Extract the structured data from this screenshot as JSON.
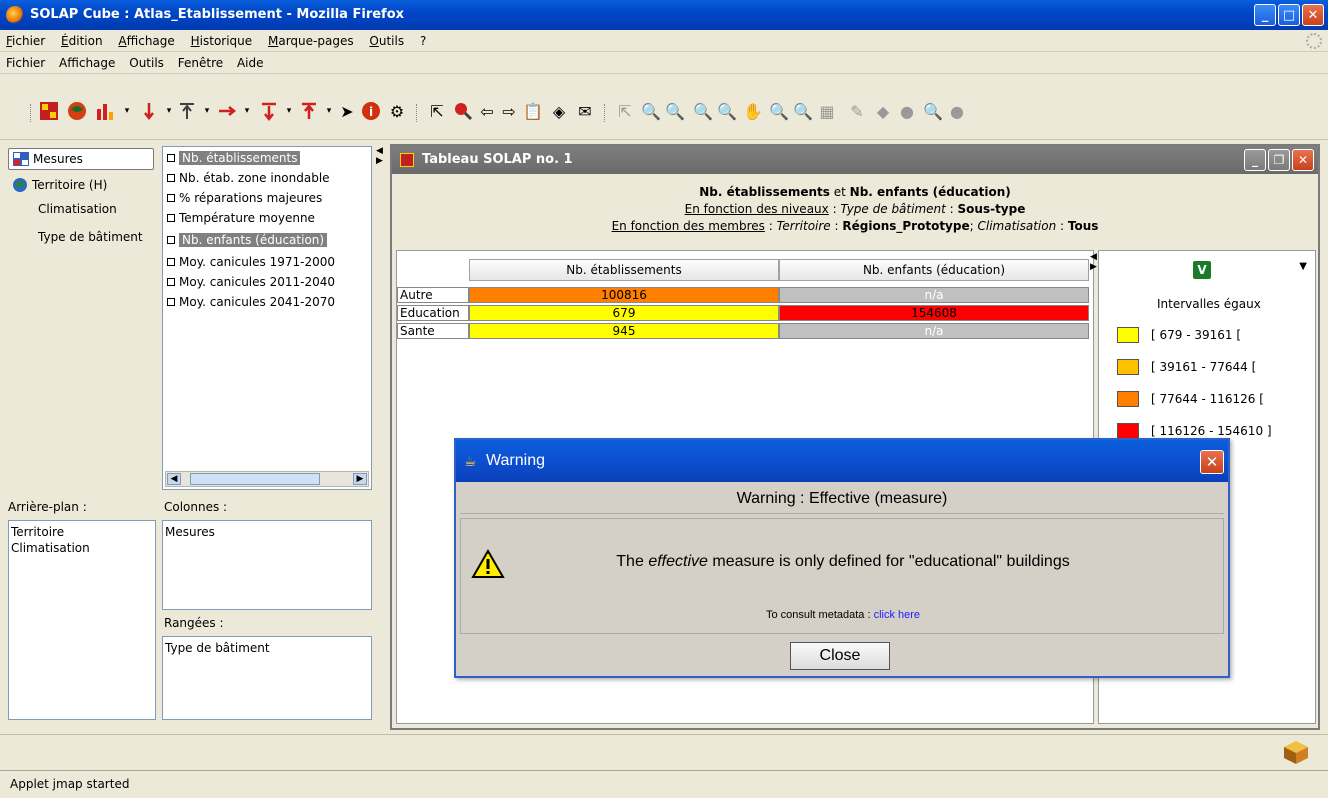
{
  "window": {
    "title": "SOLAP Cube : Atlas_Etablissement - Mozilla Firefox"
  },
  "browser_menu": [
    "Fichier",
    "Édition",
    "Affichage",
    "Historique",
    "Marque-pages",
    "Outils",
    "?"
  ],
  "app_menu": [
    "Fichier",
    "Affichage",
    "Outils",
    "Fenêtre",
    "Aide"
  ],
  "dimensions": [
    {
      "label": "Mesures",
      "icon": "measures-icon",
      "selected": true
    },
    {
      "label": "Territoire (H)",
      "icon": "globe-icon",
      "selected": false
    },
    {
      "label": "Climatisation",
      "icon": "",
      "selected": false
    },
    {
      "label": "Type de bâtiment",
      "icon": "",
      "selected": false
    }
  ],
  "measures": [
    {
      "label": "Nb. établissements",
      "selected": true
    },
    {
      "label": "Nb. étab. zone inondable",
      "selected": false
    },
    {
      "label": "% réparations majeures",
      "selected": false
    },
    {
      "label": "Température moyenne",
      "selected": false
    },
    {
      "label": "Nb. enfants (éducation)",
      "selected": true
    },
    {
      "label": "Moy. canicules 1971-2000",
      "selected": false
    },
    {
      "label": "Moy. canicules 2011-2040",
      "selected": false
    },
    {
      "label": "Moy. canicules 2041-2070",
      "selected": false
    }
  ],
  "background_section": {
    "label": "Arrière-plan :",
    "items": [
      "Territoire",
      "Climatisation"
    ]
  },
  "columns_section": {
    "label": "Colonnes :",
    "items": [
      "Mesures"
    ]
  },
  "rows_section": {
    "label": "Rangées :",
    "items": [
      "Type de bâtiment"
    ]
  },
  "inner_window": {
    "title": "Tableau SOLAP no. 1",
    "header_line1_a": "Nb. établissements",
    "header_line1_and": "et",
    "header_line1_b": "Nb. enfants (éducation)",
    "header_line2_label": "En fonction des niveaux",
    "header_line2_dim": "Type de bâtiment",
    "header_line2_value": "Sous-type",
    "header_line3_label": "En fonction des membres",
    "header_line3_dim1": "Territoire",
    "header_line3_val1": "Régions_Prototype",
    "header_line3_dim2": "Climatisation",
    "header_line3_val2": "Tous"
  },
  "table": {
    "columns": [
      "Nb. établissements",
      "Nb. enfants (éducation)"
    ],
    "rows": [
      {
        "label": "Autre",
        "values": [
          "100816",
          "n/a"
        ],
        "colors": [
          "#ff7f00",
          "#c0c0c0"
        ]
      },
      {
        "label": "Education",
        "values": [
          "679",
          "154608"
        ],
        "colors": [
          "#ffff00",
          "#ff0000"
        ]
      },
      {
        "label": "Sante",
        "values": [
          "945",
          "n/a"
        ],
        "colors": [
          "#ffff00",
          "#c0c0c0"
        ]
      }
    ]
  },
  "legend": {
    "badge": "V",
    "title": "Intervalles égaux",
    "items": [
      {
        "label": "[ 679 - 39161 [",
        "color": "#ffff00"
      },
      {
        "label": "[ 39161 - 77644 [",
        "color": "#ffc000"
      },
      {
        "label": "[ 77644 - 116126 [",
        "color": "#ff7f00"
      },
      {
        "label": "[ 116126 - 154610 ]",
        "color": "#ff0000"
      }
    ]
  },
  "dialog": {
    "title": "Warning",
    "heading": "Warning : Effective (measure)",
    "msg_before": "The",
    "msg_em": "effective",
    "msg_after": "measure is only defined for \"educational\" buildings",
    "meta_label": "To consult metadata :",
    "meta_link": "click here",
    "close_label": "Close"
  },
  "status": {
    "text": "Applet jmap started"
  }
}
